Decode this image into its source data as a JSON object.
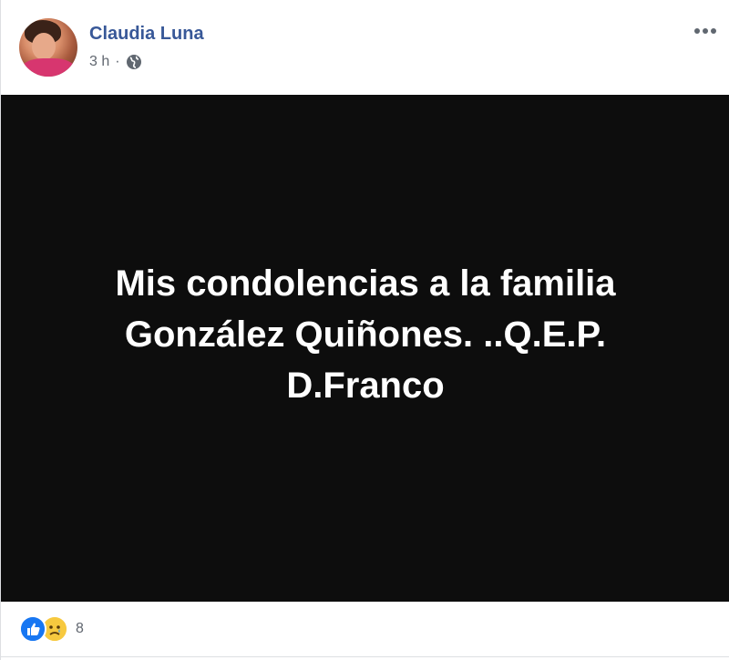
{
  "post": {
    "author": "Claudia Luna",
    "time": "3 h",
    "separator": "·",
    "privacy_icon": "globe-icon",
    "more_icon": "ellipsis-icon",
    "image_text": "Mis condolencias a la familia\nGonzález Quiñones. ..Q.E.P.\nD.Franco",
    "reactions": {
      "icons": [
        "like-icon",
        "sad-icon"
      ],
      "count": "8"
    }
  },
  "colors": {
    "author_link": "#385898",
    "meta_gray": "#616770",
    "image_background": "#0d0d0d",
    "like_blue": "#1877f2",
    "sad_yellow": "#f7c93f"
  }
}
